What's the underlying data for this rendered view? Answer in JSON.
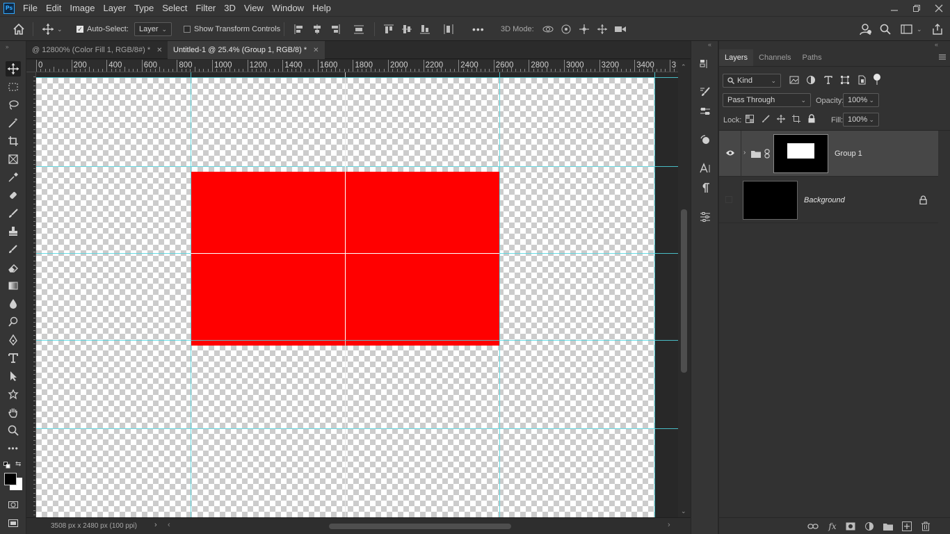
{
  "app": {
    "logo_text": "Ps"
  },
  "menu": [
    "File",
    "Edit",
    "Image",
    "Layer",
    "Type",
    "Select",
    "Filter",
    "3D",
    "View",
    "Window",
    "Help"
  ],
  "options": {
    "auto_select_label": "Auto-Select:",
    "auto_select_checked": true,
    "auto_select_target": "Layer",
    "show_transform_label": "Show Transform Controls",
    "show_transform_checked": false,
    "more_label": "•••",
    "mode_3d_label": "3D Mode:"
  },
  "tabs": [
    {
      "label": "@ 12800% (Color Fill 1, RGB/8#) *",
      "active": false
    },
    {
      "label": "Untitled-1 @ 25.4% (Group 1, RGB/8) *",
      "active": true
    }
  ],
  "ruler": {
    "h_labels": [
      "0",
      "200",
      "400",
      "600",
      "800",
      "1000",
      "1200",
      "1400",
      "1600",
      "1800",
      "2000",
      "2200",
      "2400",
      "2600",
      "2800",
      "3000",
      "3200",
      "3400",
      "3"
    ]
  },
  "canvas": {
    "fill_color": "#ff0000",
    "guide_color": "#4fd6e0"
  },
  "status": {
    "doc_info": "3508 px x 2480 px (100 ppi)"
  },
  "panel": {
    "tabs": [
      "Layers",
      "Channels",
      "Paths"
    ],
    "filter_kind": "Kind",
    "blend_mode": "Pass Through",
    "opacity_label": "Opacity:",
    "opacity_value": "100%",
    "lock_label": "Lock:",
    "fill_label": "Fill:",
    "fill_value": "100%",
    "layers": [
      {
        "name": "Group 1",
        "visible": true,
        "selected": true,
        "type": "group"
      },
      {
        "name": "Background",
        "visible": false,
        "selected": false,
        "locked": true,
        "type": "background"
      }
    ]
  }
}
